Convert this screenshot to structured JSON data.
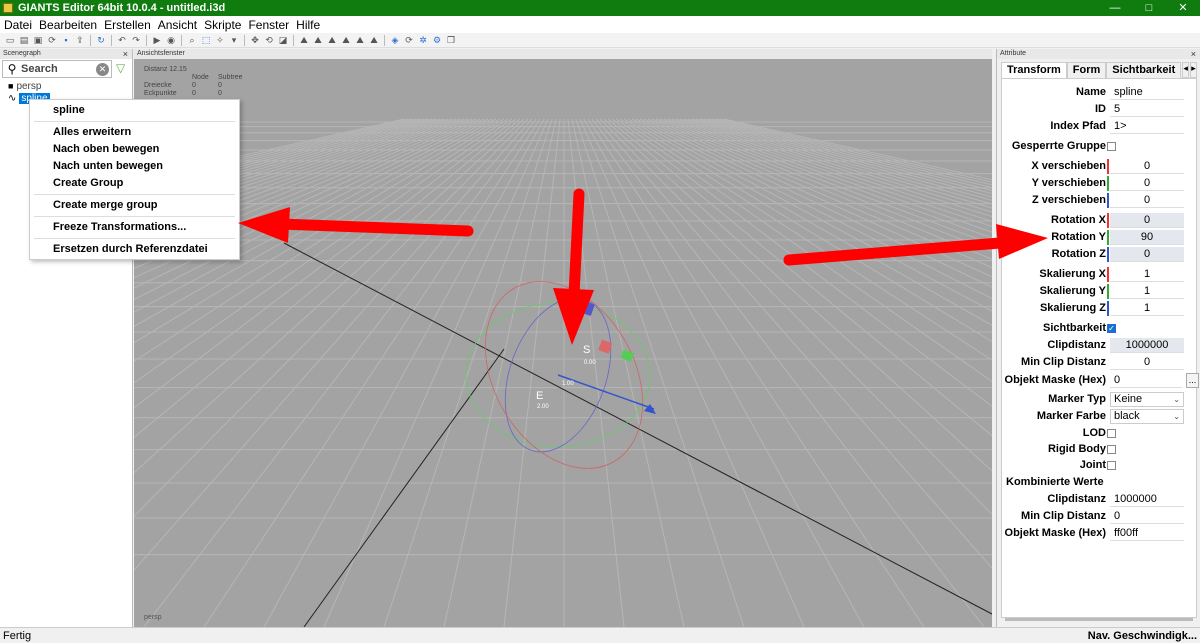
{
  "window": {
    "title": "GIANTS Editor 64bit 10.0.4 - untitled.i3d",
    "minimize": "—",
    "maximize": "□",
    "close": "✕"
  },
  "menu": [
    "Datei",
    "Bearbeiten",
    "Erstellen",
    "Ansicht",
    "Skripte",
    "Fenster",
    "Hilfe"
  ],
  "scenegraph": {
    "title": "Scenegraph",
    "search_placeholder": "Search",
    "nodes": [
      {
        "label": "persp"
      },
      {
        "label": "spline",
        "selected": true
      }
    ]
  },
  "context_menu": {
    "header": "spline",
    "items": [
      "Alles erweitern",
      "Nach oben bewegen",
      "Nach unten bewegen",
      "Create Group",
      "Create merge group",
      "Freeze Transformations...",
      "Ersetzen durch Referenzdatei"
    ]
  },
  "viewport": {
    "title": "Ansichtsfenster",
    "stats": {
      "distance": "Distanz 12.15",
      "col_node": "Node",
      "col_subtree": "Subtree",
      "rows": [
        {
          "label": "Dreiecke",
          "node": "0",
          "subtree": "0"
        },
        {
          "label": "Eckpunkte",
          "node": "0",
          "subtree": "0"
        }
      ]
    },
    "camera": "persp",
    "gizmo": {
      "start_label": "S",
      "start_value": "0.00",
      "mid_value": "1.00",
      "end_label": "E",
      "end_value": "2.00"
    }
  },
  "attributes": {
    "title": "Attribute",
    "tabs": [
      "Transform",
      "Form",
      "Sichtbarkeit"
    ],
    "name_label": "Name",
    "name_value": "spline",
    "id_label": "ID",
    "id_value": "5",
    "index_label": "Index Pfad",
    "index_value": "1>",
    "locked_label": "Gesperrte Gruppe",
    "tx_label": "X verschieben",
    "tx": "0",
    "ty_label": "Y verschieben",
    "ty": "0",
    "tz_label": "Z verschieben",
    "tz": "0",
    "rx_label": "Rotation X",
    "rx": "0",
    "ry_label": "Rotation Y",
    "ry": "90",
    "rz_label": "Rotation Z",
    "rz": "0",
    "sx_label": "Skalierung X",
    "sx": "1",
    "sy_label": "Skalierung Y",
    "sy": "1",
    "sz_label": "Skalierung Z",
    "sz": "1",
    "visibility_label": "Sichtbarkeit",
    "clip_label": "Clipdistanz",
    "clip": "1000000",
    "minclip_label": "Min Clip Distanz",
    "minclip": "0",
    "mask_label": "Objekt Maske (Hex)",
    "mask": "0",
    "mask_button": "...",
    "marker_type_label": "Marker Typ",
    "marker_type": "Keine",
    "marker_color_label": "Marker Farbe",
    "marker_color": "black",
    "lod_label": "LOD",
    "rigid_label": "Rigid Body",
    "joint_label": "Joint",
    "combined_label": "Kombinierte Werte",
    "c_clip_label": "Clipdistanz",
    "c_clip": "1000000",
    "c_minclip_label": "Min Clip Distanz",
    "c_minclip": "0",
    "c_mask_label": "Objekt Maske (Hex)",
    "c_mask": "ff00ff"
  },
  "status": {
    "left": "Fertig",
    "right": "Nav. Geschwindigk..."
  },
  "colors": {
    "titlebar": "#107c10",
    "annotation_arrow": "#ff0000",
    "axis_x": "#e33",
    "axis_y": "#3a3",
    "axis_z": "#35c"
  }
}
